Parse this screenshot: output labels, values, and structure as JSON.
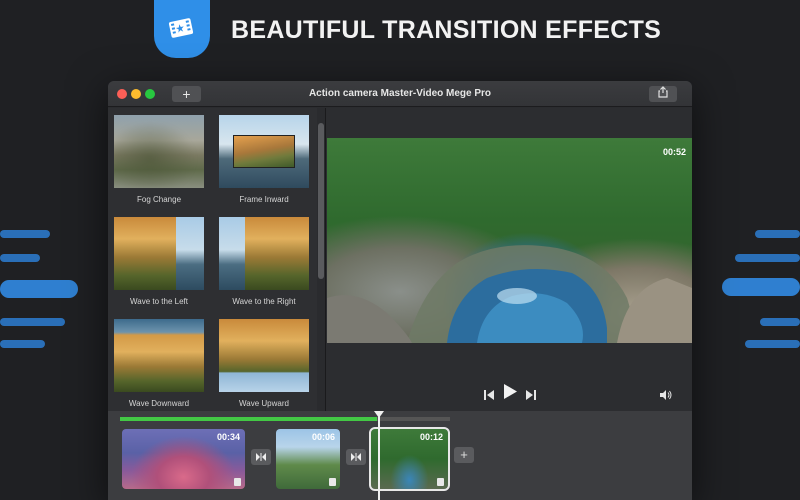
{
  "headline": "BEAUTIFUL TRANSITION EFFECTS",
  "window": {
    "title": "Action camera Master-Video Mege Pro",
    "add_label": "+"
  },
  "effects": [
    {
      "label": "Fog Change"
    },
    {
      "label": "Frame Inward"
    },
    {
      "label": "Wave to the Left"
    },
    {
      "label": "Wave to the Right"
    },
    {
      "label": "Wave Downward"
    },
    {
      "label": "Wave Upward"
    }
  ],
  "preview": {
    "duration": "00:52"
  },
  "timeline": {
    "progress": 0.78,
    "clips": [
      {
        "duration": "00:34"
      },
      {
        "duration": "00:06"
      },
      {
        "duration": "00:12"
      }
    ],
    "add_label": "+"
  },
  "colors": {
    "accent": "#2f8fe8",
    "progress": "#43c845",
    "background": "#1f2023"
  },
  "icons": [
    "film-icon",
    "share-icon",
    "skip-back-icon",
    "play-icon",
    "skip-forward-icon",
    "volume-icon",
    "transition-icon",
    "trash-icon",
    "plus-icon"
  ]
}
